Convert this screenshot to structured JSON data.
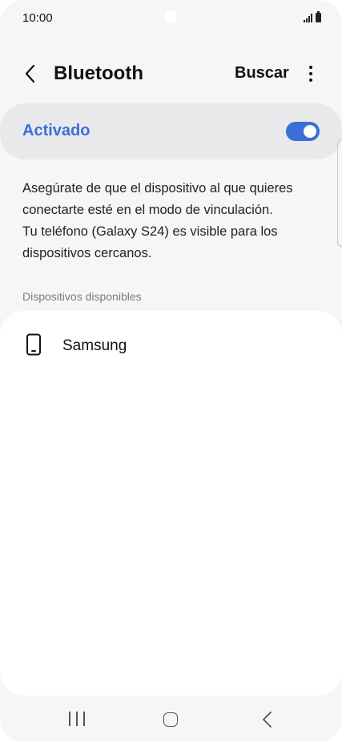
{
  "status_bar": {
    "time": "10:00"
  },
  "header": {
    "title": "Bluetooth",
    "search_label": "Buscar",
    "back_icon": "chevron-left-icon",
    "more_icon": "more-vertical-icon"
  },
  "toggle": {
    "label": "Activado",
    "state": "on",
    "accent_color": "#3a6fd8"
  },
  "description": {
    "line1": "Asegúrate de que el dispositivo al que quieres",
    "line2": "conectarte esté en el modo de vinculación.",
    "line3": "Tu teléfono (Galaxy S24) es visible para los",
    "line4": "dispositivos cercanos."
  },
  "available_devices": {
    "section_title": "Dispositivos disponibles",
    "items": [
      {
        "name": "Samsung",
        "icon": "smartphone-icon"
      }
    ]
  },
  "nav_bar": {
    "recents_icon": "recents-icon",
    "home_icon": "home-icon",
    "back_icon": "back-icon"
  }
}
